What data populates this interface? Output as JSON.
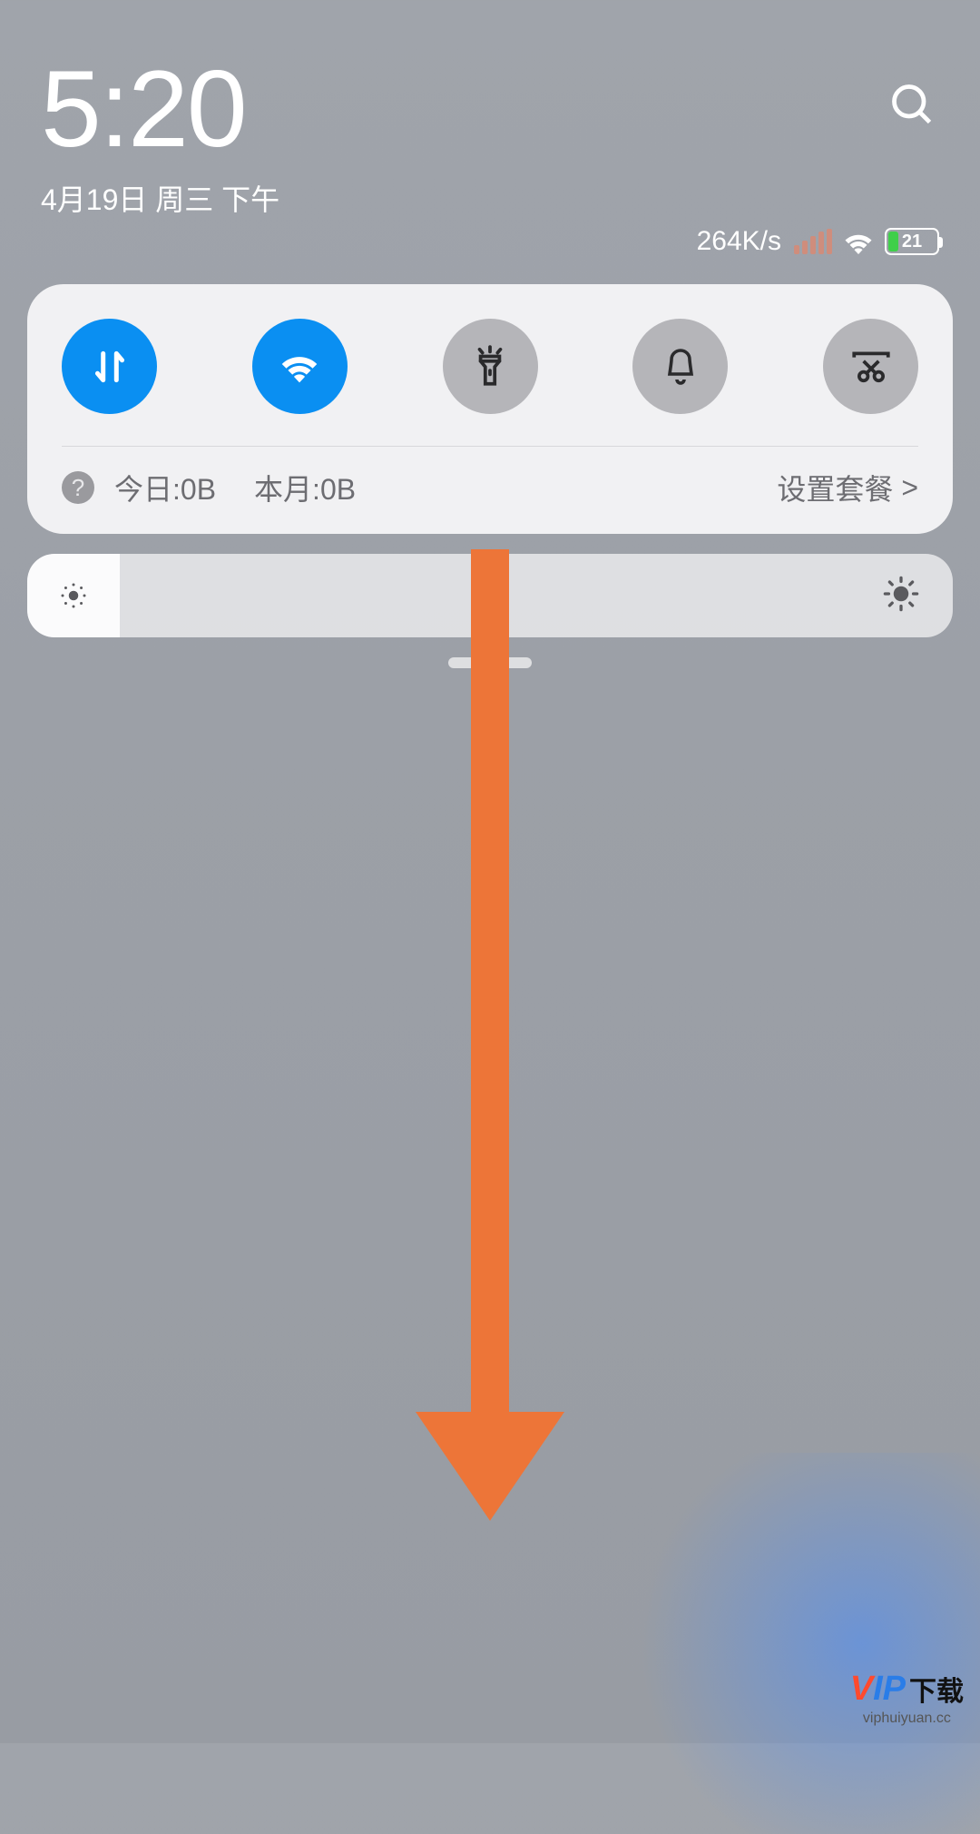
{
  "header": {
    "time": "5:20",
    "date": "4月19日 周三 下午",
    "netspeed": "264K/s",
    "battery_pct": "21"
  },
  "toggles": {
    "data": {
      "name": "mobile-data",
      "active": true
    },
    "wifi": {
      "name": "wifi",
      "active": true
    },
    "flashlight": {
      "name": "flashlight",
      "active": false
    },
    "mute": {
      "name": "mute",
      "active": false
    },
    "screenshot": {
      "name": "screenshot",
      "active": false
    }
  },
  "data_usage": {
    "today": "今日:0B",
    "month": "本月:0B",
    "plan": "设置套餐",
    "plan_arrow": ">"
  },
  "watermark": {
    "v": "V",
    "ip": "IP",
    "dl": "下载",
    "url": "viphuiyuan.cc"
  }
}
